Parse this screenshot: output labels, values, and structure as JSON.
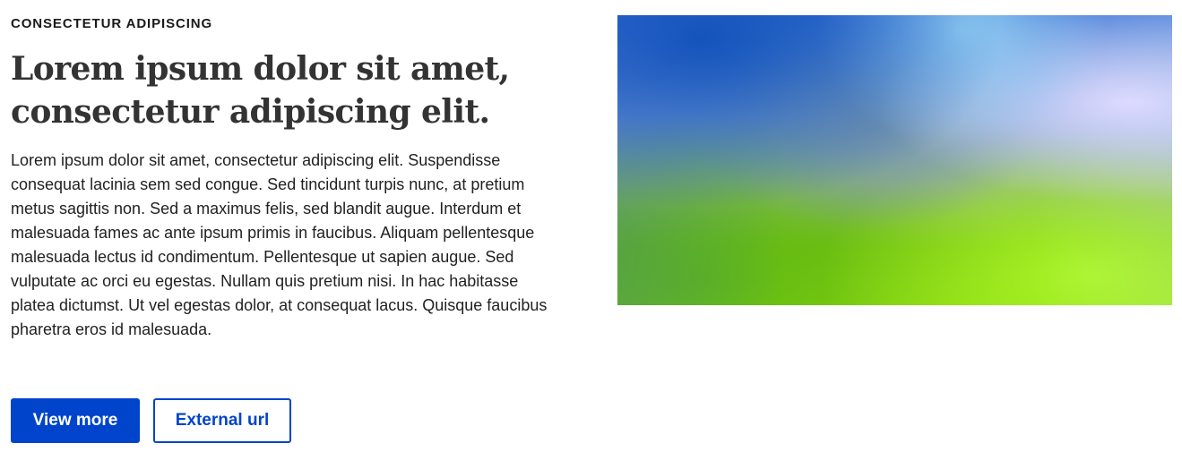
{
  "banner": {
    "eyebrow": "CONSECTETUR ADIPISCING",
    "title": "Lorem ipsum dolor sit amet, consectetur adipiscing elit.",
    "body": "Lorem ipsum dolor sit amet, consectetur adipiscing elit. Suspendisse consequat lacinia sem sed congue. Sed tincidunt turpis nunc, at pretium metus sagittis non. Sed a maximus felis, sed blandit augue. Interdum et malesuada fames ac ante ipsum primis in faucibus. Aliquam pellentesque malesuada lectus id condimentum. Pellentesque ut sapien augue. Sed vulputate ac orci eu egestas. Nullam quis pretium nisi. In hac habitasse platea dictumst. Ut vel egestas dolor, at consequat lacus. Quisque faucibus pharetra eros id malesuada.",
    "buttons": {
      "primary_label": "View more",
      "secondary_label": "External url"
    }
  },
  "colors": {
    "accent": "#0044cc",
    "text": "#333333",
    "background": "#ffffff"
  }
}
